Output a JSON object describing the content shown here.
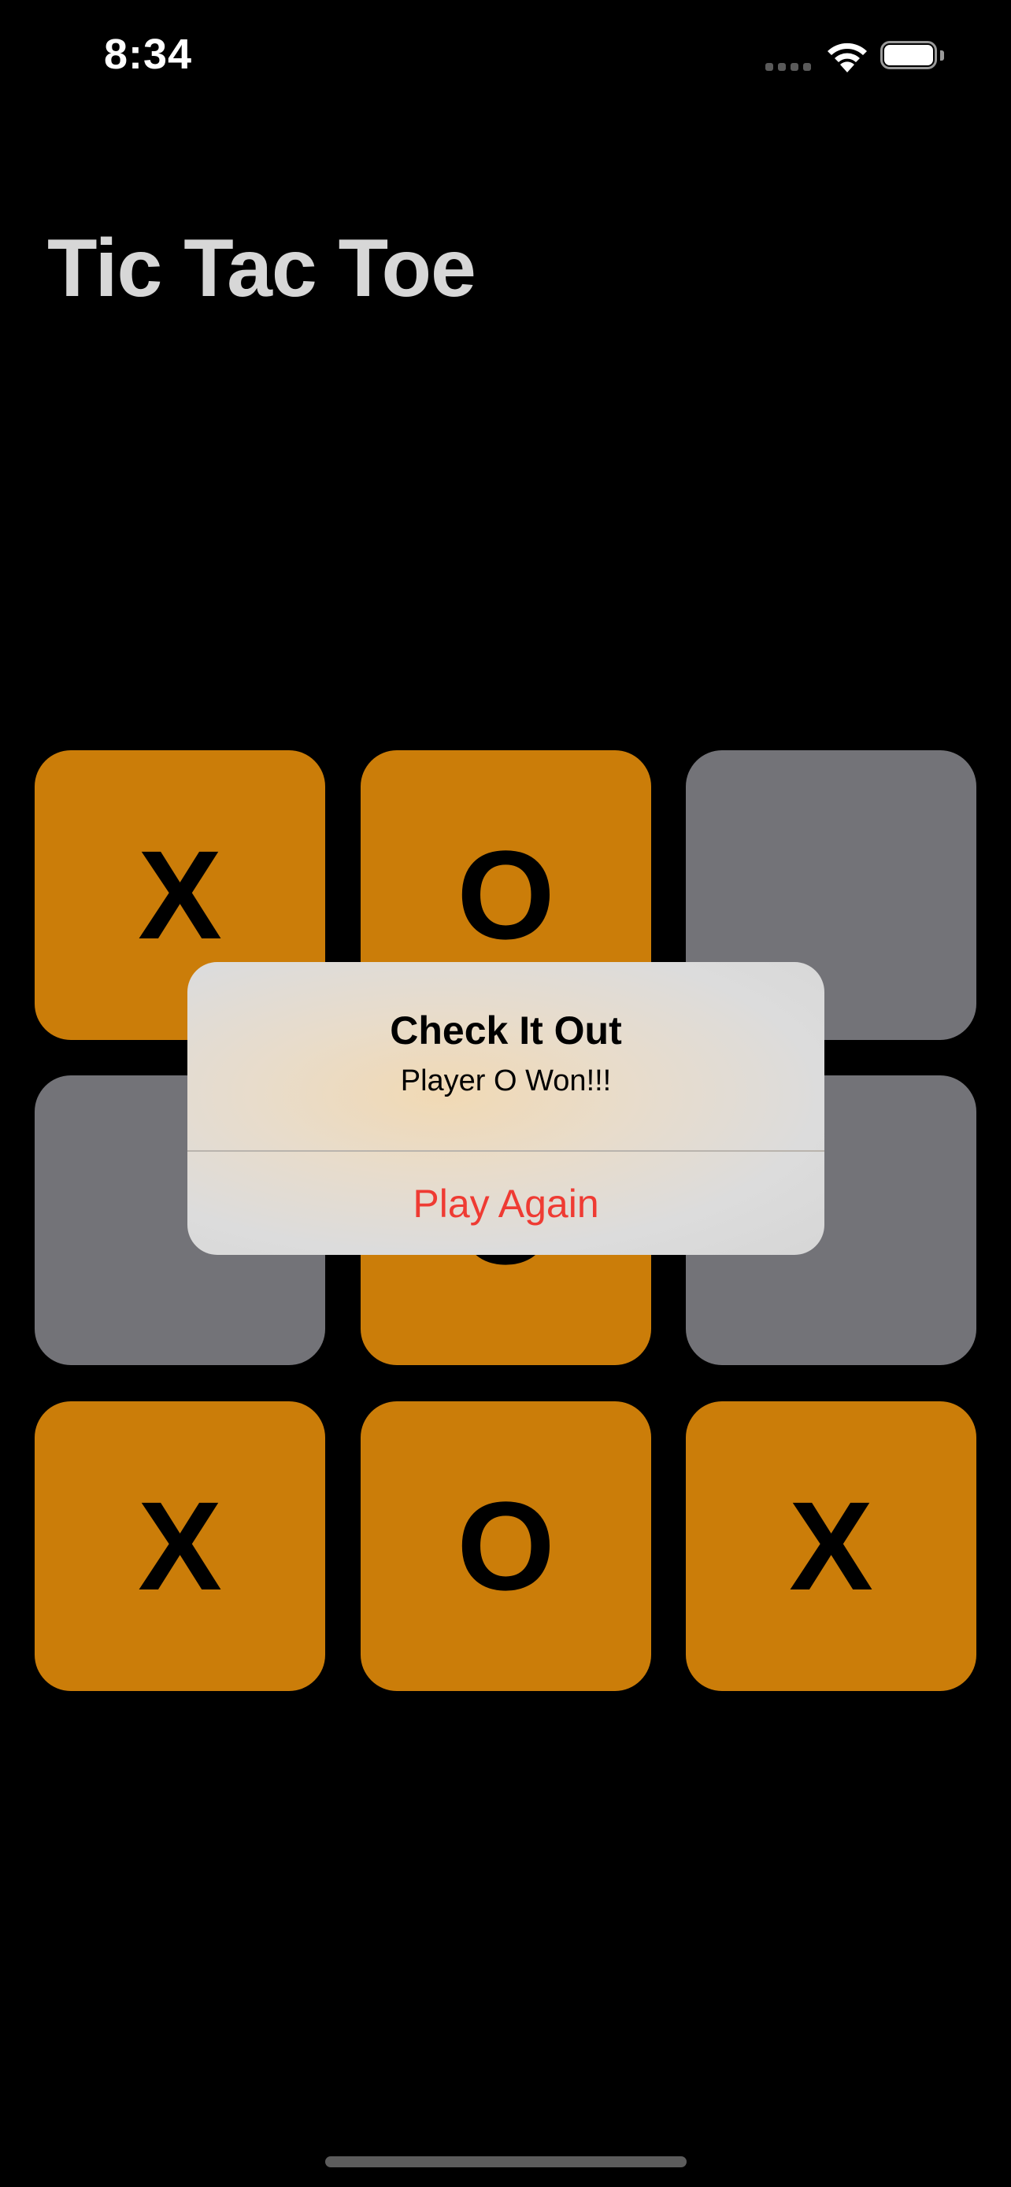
{
  "status_bar": {
    "time": "8:34",
    "icons": [
      "cellular-signal-icon",
      "wifi-icon",
      "battery-icon"
    ]
  },
  "title": "Tic Tac Toe",
  "board": {
    "cells": [
      {
        "mark": "X",
        "state": "filled"
      },
      {
        "mark": "O",
        "state": "filled"
      },
      {
        "mark": "",
        "state": "empty"
      },
      {
        "mark": "",
        "state": "empty"
      },
      {
        "mark": "O",
        "state": "filled"
      },
      {
        "mark": "",
        "state": "empty"
      },
      {
        "mark": "X",
        "state": "filled"
      },
      {
        "mark": "O",
        "state": "filled"
      },
      {
        "mark": "X",
        "state": "filled"
      }
    ]
  },
  "alert": {
    "title": "Check It Out",
    "message": "Player O Won!!!",
    "button_label": "Play Again"
  },
  "colors": {
    "background": "#000000",
    "filled_cell": "#cb7d09",
    "empty_cell": "#737378",
    "title_text": "#d7d7d7",
    "alert_button_text": "#ef3b33"
  }
}
